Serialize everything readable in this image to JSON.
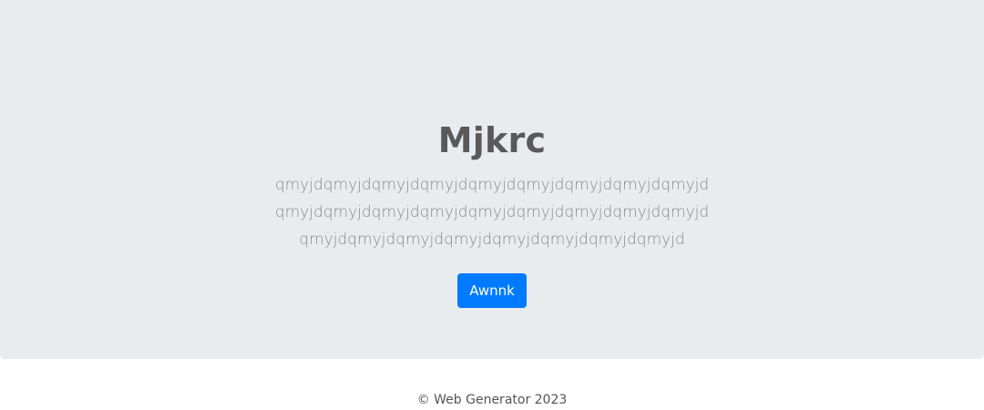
{
  "hero": {
    "title": "Mjkrc",
    "subtitle": "qmyjdqmyjdqmyjdqmyjdqmyjdqmyjdqmyjdqmyjdqmyjd qmyjdqmyjdqmyjdqmyjdqmyjdqmyjdqmyjdqmyjdqmyjd qmyjdqmyjdqmyjdqmyjdqmyjdqmyjdqmyjdqmyjd",
    "button_label": "Awnnk",
    "button_color": "#007bff",
    "background_color": "#e9ecef"
  },
  "footer": {
    "text": "© Web Generator 2023"
  }
}
